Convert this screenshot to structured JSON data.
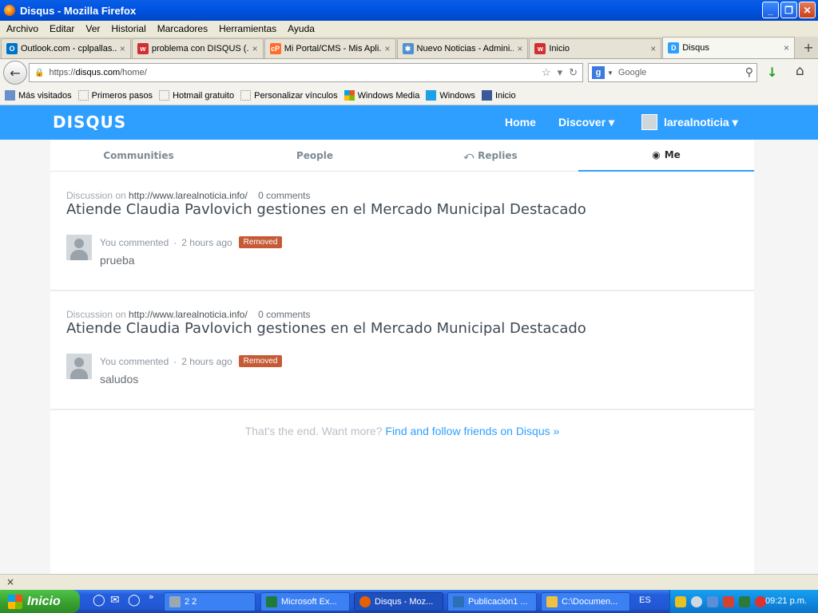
{
  "window": {
    "title": "Disqus - Mozilla Firefox",
    "minimize": "_",
    "restore": "❐",
    "close": "✕"
  },
  "menu": [
    "Archivo",
    "Editar",
    "Ver",
    "Historial",
    "Marcadores",
    "Herramientas",
    "Ayuda"
  ],
  "tabs": [
    {
      "label": "Outlook.com - cplpallas...",
      "icon": "outlook-icon",
      "color": "#0072c6",
      "glyph": "O"
    },
    {
      "label": "problema con DISQUS (...",
      "icon": "wordpress-w-icon",
      "color": "#d23030",
      "glyph": "w"
    },
    {
      "label": "Mi Portal/CMS - Mis Apli...",
      "icon": "cpanel-icon",
      "color": "#ff6c2c",
      "glyph": "cP"
    },
    {
      "label": "Nuevo Noticias - Admini...",
      "icon": "joomla-icon",
      "color": "#5091cd",
      "glyph": "✱"
    },
    {
      "label": "Inicio",
      "icon": "wordpress-w-icon",
      "color": "#d23030",
      "glyph": "w"
    },
    {
      "label": "Disqus",
      "icon": "disqus-icon",
      "color": "#2e9fff",
      "glyph": "D"
    }
  ],
  "tab_close": "×",
  "new_tab": "+",
  "url": {
    "prefix": "https://",
    "host": "disqus.com",
    "path": "/home/"
  },
  "search": {
    "engine_glyph": "g",
    "placeholder": "Google"
  },
  "bookmarks": [
    "Más visitados",
    "Primeros pasos",
    "Hotmail gratuito",
    "Personalizar vínculos",
    "Windows Media",
    "Windows",
    "Inicio"
  ],
  "disqus": {
    "logo": "DISQUS",
    "nav_home": "Home",
    "nav_discover": "Discover ▾",
    "nav_user": "larealnoticia ▾",
    "subtabs": {
      "communities": "Communities",
      "people": "People",
      "replies": "Replies",
      "me": "Me"
    },
    "posts": [
      {
        "discussion_label": "Discussion on",
        "site": "http://www.larealnoticia.info/",
        "comments": "0 comments",
        "title": "Atiende Claudia Pavlovich gestiones en el Mercado Municipal Destacado",
        "action": "You commented",
        "time": "2 hours ago",
        "badge": "Removed",
        "text": "prueba"
      },
      {
        "discussion_label": "Discussion on",
        "site": "http://www.larealnoticia.info/",
        "comments": "0 comments",
        "title": "Atiende Claudia Pavlovich gestiones en el Mercado Municipal Destacado",
        "action": "You commented",
        "time": "2 hours ago",
        "badge": "Removed",
        "text": "saludos"
      }
    ],
    "end_text": "That's the end. Want more?",
    "end_link": "Find and follow friends on Disqus »"
  },
  "findbar": {
    "close": "×"
  },
  "taskbar": {
    "start": "Inicio",
    "items": [
      {
        "label": "2 2",
        "color": "#9aa7b6"
      },
      {
        "label": "Microsoft Ex...",
        "color": "#1f7a3b"
      },
      {
        "label": "Disqus - Moz...",
        "color": "#e66000"
      },
      {
        "label": "Publicación1 ...",
        "color": "#2a6fb8"
      },
      {
        "label": "C:\\Documen...",
        "color": "#f0c040"
      }
    ],
    "lang": "ES",
    "clock": "09:21 p.m."
  },
  "colors": {
    "disqus_blue": "#2e9fff",
    "removed_badge": "#c55a35"
  }
}
